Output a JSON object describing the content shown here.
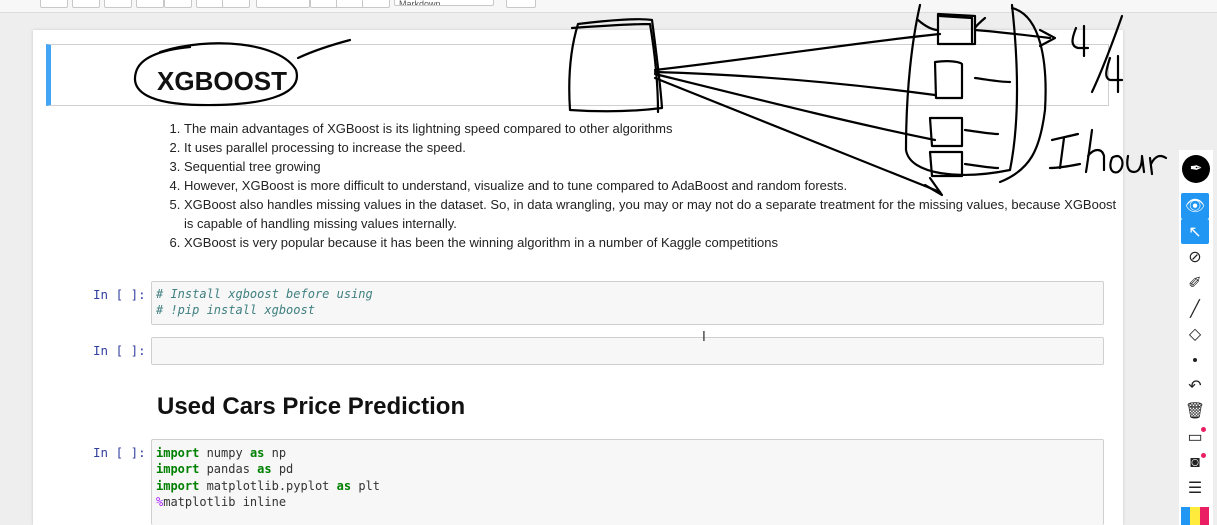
{
  "toolbar": {
    "cell_type": "Markdown"
  },
  "notebook": {
    "title_cell": {
      "heading": "XGBOOST"
    },
    "advantages": [
      "The main advantages of XGBoost is its lightning speed compared to other algorithms",
      "It uses parallel processing to increase the speed.",
      "Sequential tree growing",
      "However, XGBoost is more difficult to understand, visualize and to tune compared to AdaBoost and random forests.",
      "XGBoost also handles missing values in the dataset. So, in data wrangling, you may or may not do a separate treatment for the missing values, because XGBoost is capable of handling missing values internally.",
      "XGBoost is very popular because it has been the winning algorithm in a number of Kaggle competitions"
    ],
    "cells": [
      {
        "prompt": "In [ ]:",
        "lines": [
          "# Install xgboost before using",
          "# !pip install xgboost"
        ]
      },
      {
        "prompt": "In [ ]:",
        "lines": []
      },
      {
        "prompt": "In [ ]:",
        "lines": [
          "import numpy as np",
          "import pandas as pd",
          "import matplotlib.pyplot as plt",
          "%matplotlib inline"
        ]
      }
    ],
    "section_heading": "Used Cars Price Prediction"
  },
  "annotation": {
    "ratio_label": "4/4",
    "time_label": "1 hour",
    "color": "#000000"
  },
  "drawing_palette": {
    "accent": "#2196f3",
    "tools": [
      "eye-icon",
      "pointer-icon",
      "pen-off-icon",
      "highlighter-icon",
      "marker-icon",
      "eraser-icon",
      "dot-size-icon",
      "undo-icon",
      "trash-icon",
      "whiteboard-icon",
      "camera-icon",
      "notes-icon"
    ],
    "colors": [
      "#2196f3",
      "#ffeb3b",
      "#e91e63"
    ]
  }
}
